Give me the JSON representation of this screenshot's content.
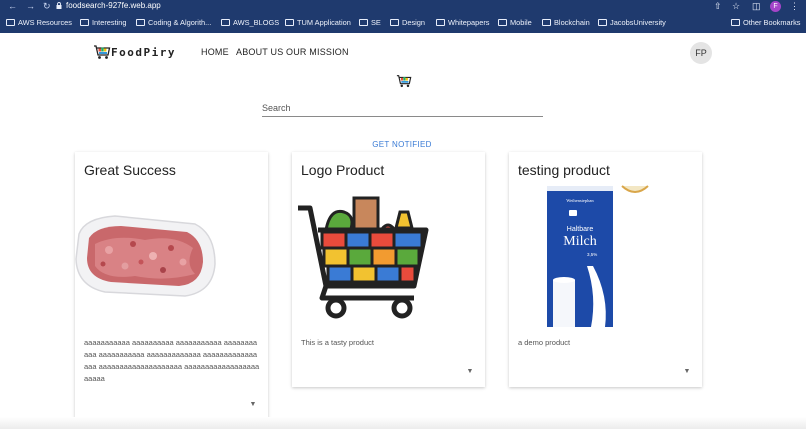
{
  "browser": {
    "url": "foodsearch-927fe.web.app",
    "profile_initial": "F",
    "bookmarks": [
      {
        "label": "AWS Resources"
      },
      {
        "label": "Interesting"
      },
      {
        "label": "Coding & Algorith..."
      },
      {
        "label": "AWS_BLOGS"
      },
      {
        "label": "TUM Application"
      },
      {
        "label": "SE"
      },
      {
        "label": "Design"
      },
      {
        "label": "Whitepapers"
      },
      {
        "label": "Mobile"
      },
      {
        "label": "Blockchain"
      },
      {
        "label": "JacobsUniversity"
      }
    ],
    "other_bookmarks": "Other Bookmarks"
  },
  "header": {
    "brand": "FoodPiry",
    "nav": [
      "HOME",
      "ABOUT US",
      "OUR MISSION"
    ],
    "avatar_initials": "FP"
  },
  "search": {
    "placeholder": "Search",
    "value": ""
  },
  "notify_label": "GET NOTIFIED",
  "products": [
    {
      "title": "Great Success",
      "image": "ground-meat-tray",
      "description": "aaaaaaaaaaa aaaaaaaaaa aaaaaaaaaaa aaaaaaaaaaa aaaaaaaaaaa aaaaaaaaaaaaa aaaaaaaaaaaaaaaa aaaaaaaaaaaaaaaaaaaa aaaaaaaaaaaaaaaaaaaaaaa"
    },
    {
      "title": "Logo Product",
      "image": "grocery-cart-logo",
      "description": "This is a tasty product"
    },
    {
      "title": "testing product",
      "image": "milk-carton",
      "milk_brand": "Weihenstephan",
      "milk_label_1": "Haltbare",
      "milk_label_2": "Milch",
      "milk_fat": "3,5%",
      "description": "a demo product"
    }
  ],
  "colors": {
    "browser_bar": "#1f3a6e",
    "link_blue": "#3a7bd5",
    "avatar_bg": "#e4e4e4"
  }
}
